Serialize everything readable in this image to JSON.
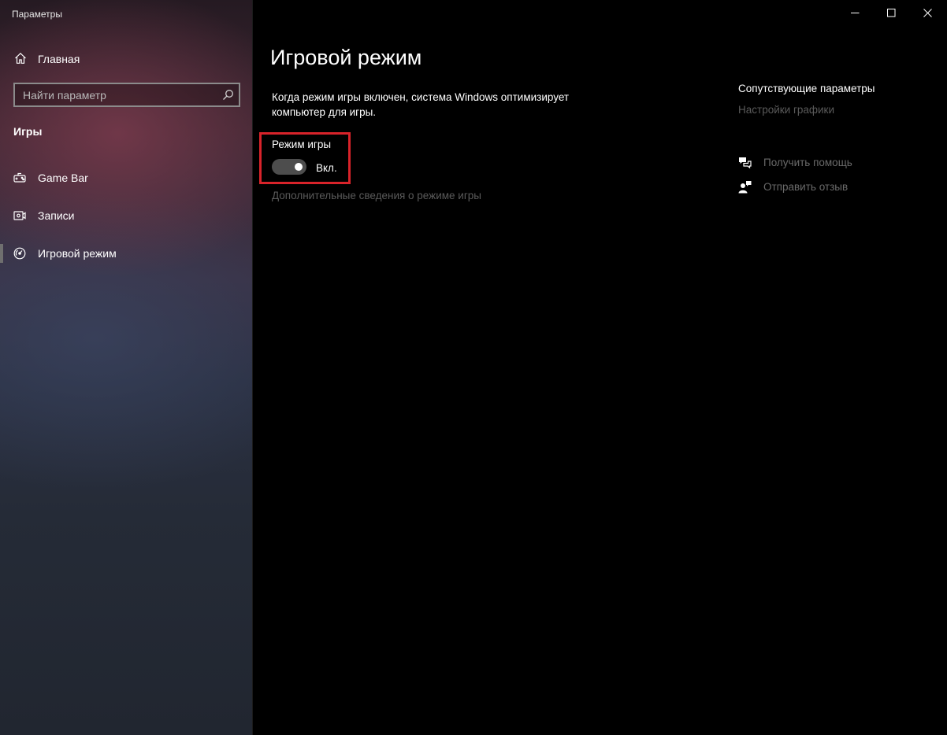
{
  "window": {
    "title": "Параметры"
  },
  "sidebar": {
    "home_label": "Главная",
    "search_placeholder": "Найти параметр",
    "section_heading": "Игры",
    "items": [
      {
        "label": "Game Bar",
        "icon": "game-bar-icon"
      },
      {
        "label": "Записи",
        "icon": "captures-icon"
      },
      {
        "label": "Игровой режим",
        "icon": "game-mode-icon",
        "selected": true
      }
    ]
  },
  "main": {
    "title": "Игровой режим",
    "description": "Когда режим игры включен, система Windows оптимизирует компьютер для игры.",
    "toggle": {
      "label": "Режим игры",
      "state_text": "Вкл.",
      "on": true
    },
    "more_info_link": "Дополнительные сведения о режиме игры"
  },
  "related": {
    "title": "Сопутствующие параметры",
    "link": "Настройки графики",
    "help_items": [
      {
        "label": "Получить помощь",
        "icon": "get-help-icon"
      },
      {
        "label": "Отправить отзыв",
        "icon": "feedback-icon"
      }
    ]
  },
  "colors": {
    "highlight": "#d8232a",
    "toggle_track": "#4d4d4d",
    "dim_link": "#5a5a5a"
  }
}
